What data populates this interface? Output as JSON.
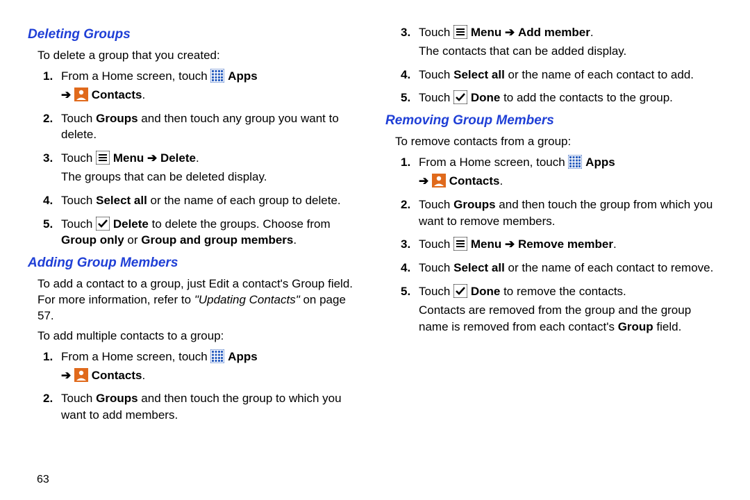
{
  "headings": {
    "deleting": "Deleting Groups",
    "adding": "Adding Group Members",
    "removing": "Removing Group Members"
  },
  "intro": {
    "deleting": "To delete a group that you created:",
    "adding_para": "To add a contact to a group, just Edit a contact's Group field. For more information, refer to ",
    "adding_ref": "\"Updating Contacts\"",
    "adding_ref_tail": " on page 57.",
    "adding_sub": "To add multiple contacts to a group:",
    "removing": "To remove contacts from a group:"
  },
  "labels": {
    "apps": "Apps",
    "contacts": "Contacts",
    "menu": "Menu",
    "delete": "Delete",
    "done": "Done",
    "add_member": "Add member",
    "remove_member": "Remove member",
    "select_all": "Select all",
    "groups": "Groups",
    "group_only": "Group only",
    "group_and_members": "Group and group members",
    "group_field": "Group",
    "arrow": "➔",
    "touch": "Touch",
    "from_home": "From a Home screen, touch"
  },
  "sentences": {
    "del_step2_a": " and then touch any group you want to delete.",
    "del_step3_b": "The groups that can be deleted display.",
    "del_step4_tail": " or the name of each group to delete.",
    "del_step5_mid": " to delete the groups. Choose from ",
    "del_step5_or": " or ",
    "del_step5_end": ".",
    "add_step2_a": " and then touch the group to which you want to add members.",
    "add_step3_b": "The contacts that can be added display.",
    "add_step4_tail": " or the name of each contact to add.",
    "add_step5_tail": " to add the contacts to the group.",
    "rem_step2_a": " and then touch the group from which you want to remove members.",
    "rem_step4_tail": " or the name of each contact to remove.",
    "rem_step5_tail": " to remove the contacts.",
    "rem_after": "Contacts are removed from the group and the group name is removed from each contact's ",
    "rem_after_end": " field."
  },
  "page_number": "63"
}
